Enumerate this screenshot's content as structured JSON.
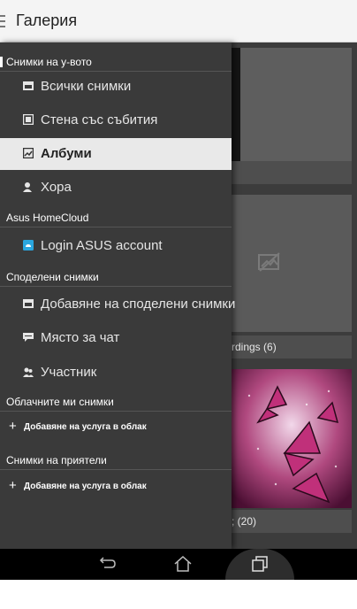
{
  "app": {
    "title": "Галерия"
  },
  "drawer": {
    "sections": [
      {
        "header": "Снимки на у-вото",
        "items": [
          {
            "label": "Всички снимки",
            "icon": "photos-icon"
          },
          {
            "label": "Стена със събития",
            "icon": "events-wall-icon"
          },
          {
            "label": "Албуми",
            "icon": "albums-icon",
            "selected": true
          },
          {
            "label": "Хора",
            "icon": "person-icon"
          }
        ]
      },
      {
        "header": "Asus HomeCloud",
        "items": [
          {
            "label": "Login ASUS account",
            "icon": "cloud-login-icon"
          }
        ]
      },
      {
        "header": "Споделени снимки",
        "items": [
          {
            "label": "Добавяне на споделени снимки",
            "icon": "shared-photos-icon"
          },
          {
            "label": "Място за чат",
            "icon": "chat-icon"
          },
          {
            "label": "Участник",
            "icon": "participants-icon"
          }
        ]
      },
      {
        "header": "Облачните ми снимки",
        "add_label": "Добавяне на услуга в облак"
      },
      {
        "header": "Снимки на приятели",
        "add_label": "Добавяне на услуга в облак"
      }
    ]
  },
  "background": {
    "album_labels": [
      "rdings (6)",
      "; (20)"
    ]
  },
  "navbar": {
    "buttons": [
      "back-icon",
      "home-icon",
      "recents-icon"
    ]
  },
  "colors": {
    "drawer_bg": "#3a3a3a",
    "selected_bg": "#e9e9e9",
    "appbar_bg": "#f4f4f4",
    "accent_cloud": "#2aa7e0"
  }
}
